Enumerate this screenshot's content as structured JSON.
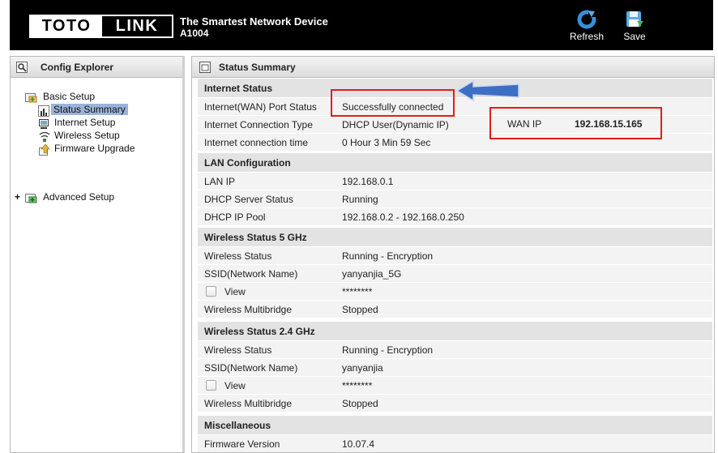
{
  "header": {
    "logo_left": "TOTO",
    "logo_right": "LINK",
    "tagline": "The Smartest Network Device",
    "model": "A1004",
    "refresh_label": "Refresh",
    "save_label": "Save"
  },
  "left_panel": {
    "title": "Config Explorer",
    "tree": [
      {
        "label": "Basic Setup",
        "icon": "folder-icon",
        "expanded": true
      },
      {
        "label": "Status Summary",
        "icon": "chart-icon",
        "selected": true
      },
      {
        "label": "Internet Setup",
        "icon": "computer-icon"
      },
      {
        "label": "Wireless Setup",
        "icon": "wireless-icon"
      },
      {
        "label": "Firmware Upgrade",
        "icon": "upgrade-icon"
      },
      {
        "label": "Advanced Setup",
        "icon": "folder-icon",
        "expand_toggle": "+"
      }
    ]
  },
  "right_panel": {
    "title": "Status Summary",
    "sections": {
      "internet": {
        "title": "Internet Status",
        "rows": [
          {
            "label": "Internet(WAN) Port Status",
            "value": "Successfully connected"
          },
          {
            "label": "Internet Connection Type",
            "value": "DHCP User(Dynamic IP)"
          },
          {
            "label": "Internet connection time",
            "value": "0 Hour 3 Min 59 Sec"
          }
        ]
      },
      "lan": {
        "title": "LAN Configuration",
        "rows": [
          {
            "label": "LAN IP",
            "value": "192.168.0.1"
          },
          {
            "label": "DHCP Server Status",
            "value": "Running"
          },
          {
            "label": "DHCP IP Pool",
            "value": "192.168.0.2 -  192.168.0.250"
          }
        ]
      },
      "wireless5": {
        "title": "Wireless Status 5 GHz",
        "rows": [
          {
            "label": "Wireless Status",
            "value": "Running - Encryption"
          },
          {
            "label": "SSID(Network Name)",
            "value": "yanyanjia_5G"
          },
          {
            "label": "View",
            "value": "********"
          },
          {
            "label": "Wireless Multibridge",
            "value": "Stopped"
          }
        ]
      },
      "wireless24": {
        "title": "Wireless Status 2.4 GHz",
        "rows": [
          {
            "label": "Wireless Status",
            "value": "Running - Encryption"
          },
          {
            "label": "SSID(Network Name)",
            "value": "yanyanjia"
          },
          {
            "label": "View",
            "value": "********"
          },
          {
            "label": "Wireless Multibridge",
            "value": "Stopped"
          }
        ]
      },
      "misc": {
        "title": "Miscellaneous",
        "rows": [
          {
            "label": "Firmware Version",
            "value": "10.07.4"
          }
        ]
      }
    }
  },
  "annotation": {
    "wan_ip_label": "WAN IP",
    "wan_ip_value": "192.168.15.165",
    "highlight_color": "#e01e1e",
    "arrow_color": "#3f6fc4"
  }
}
